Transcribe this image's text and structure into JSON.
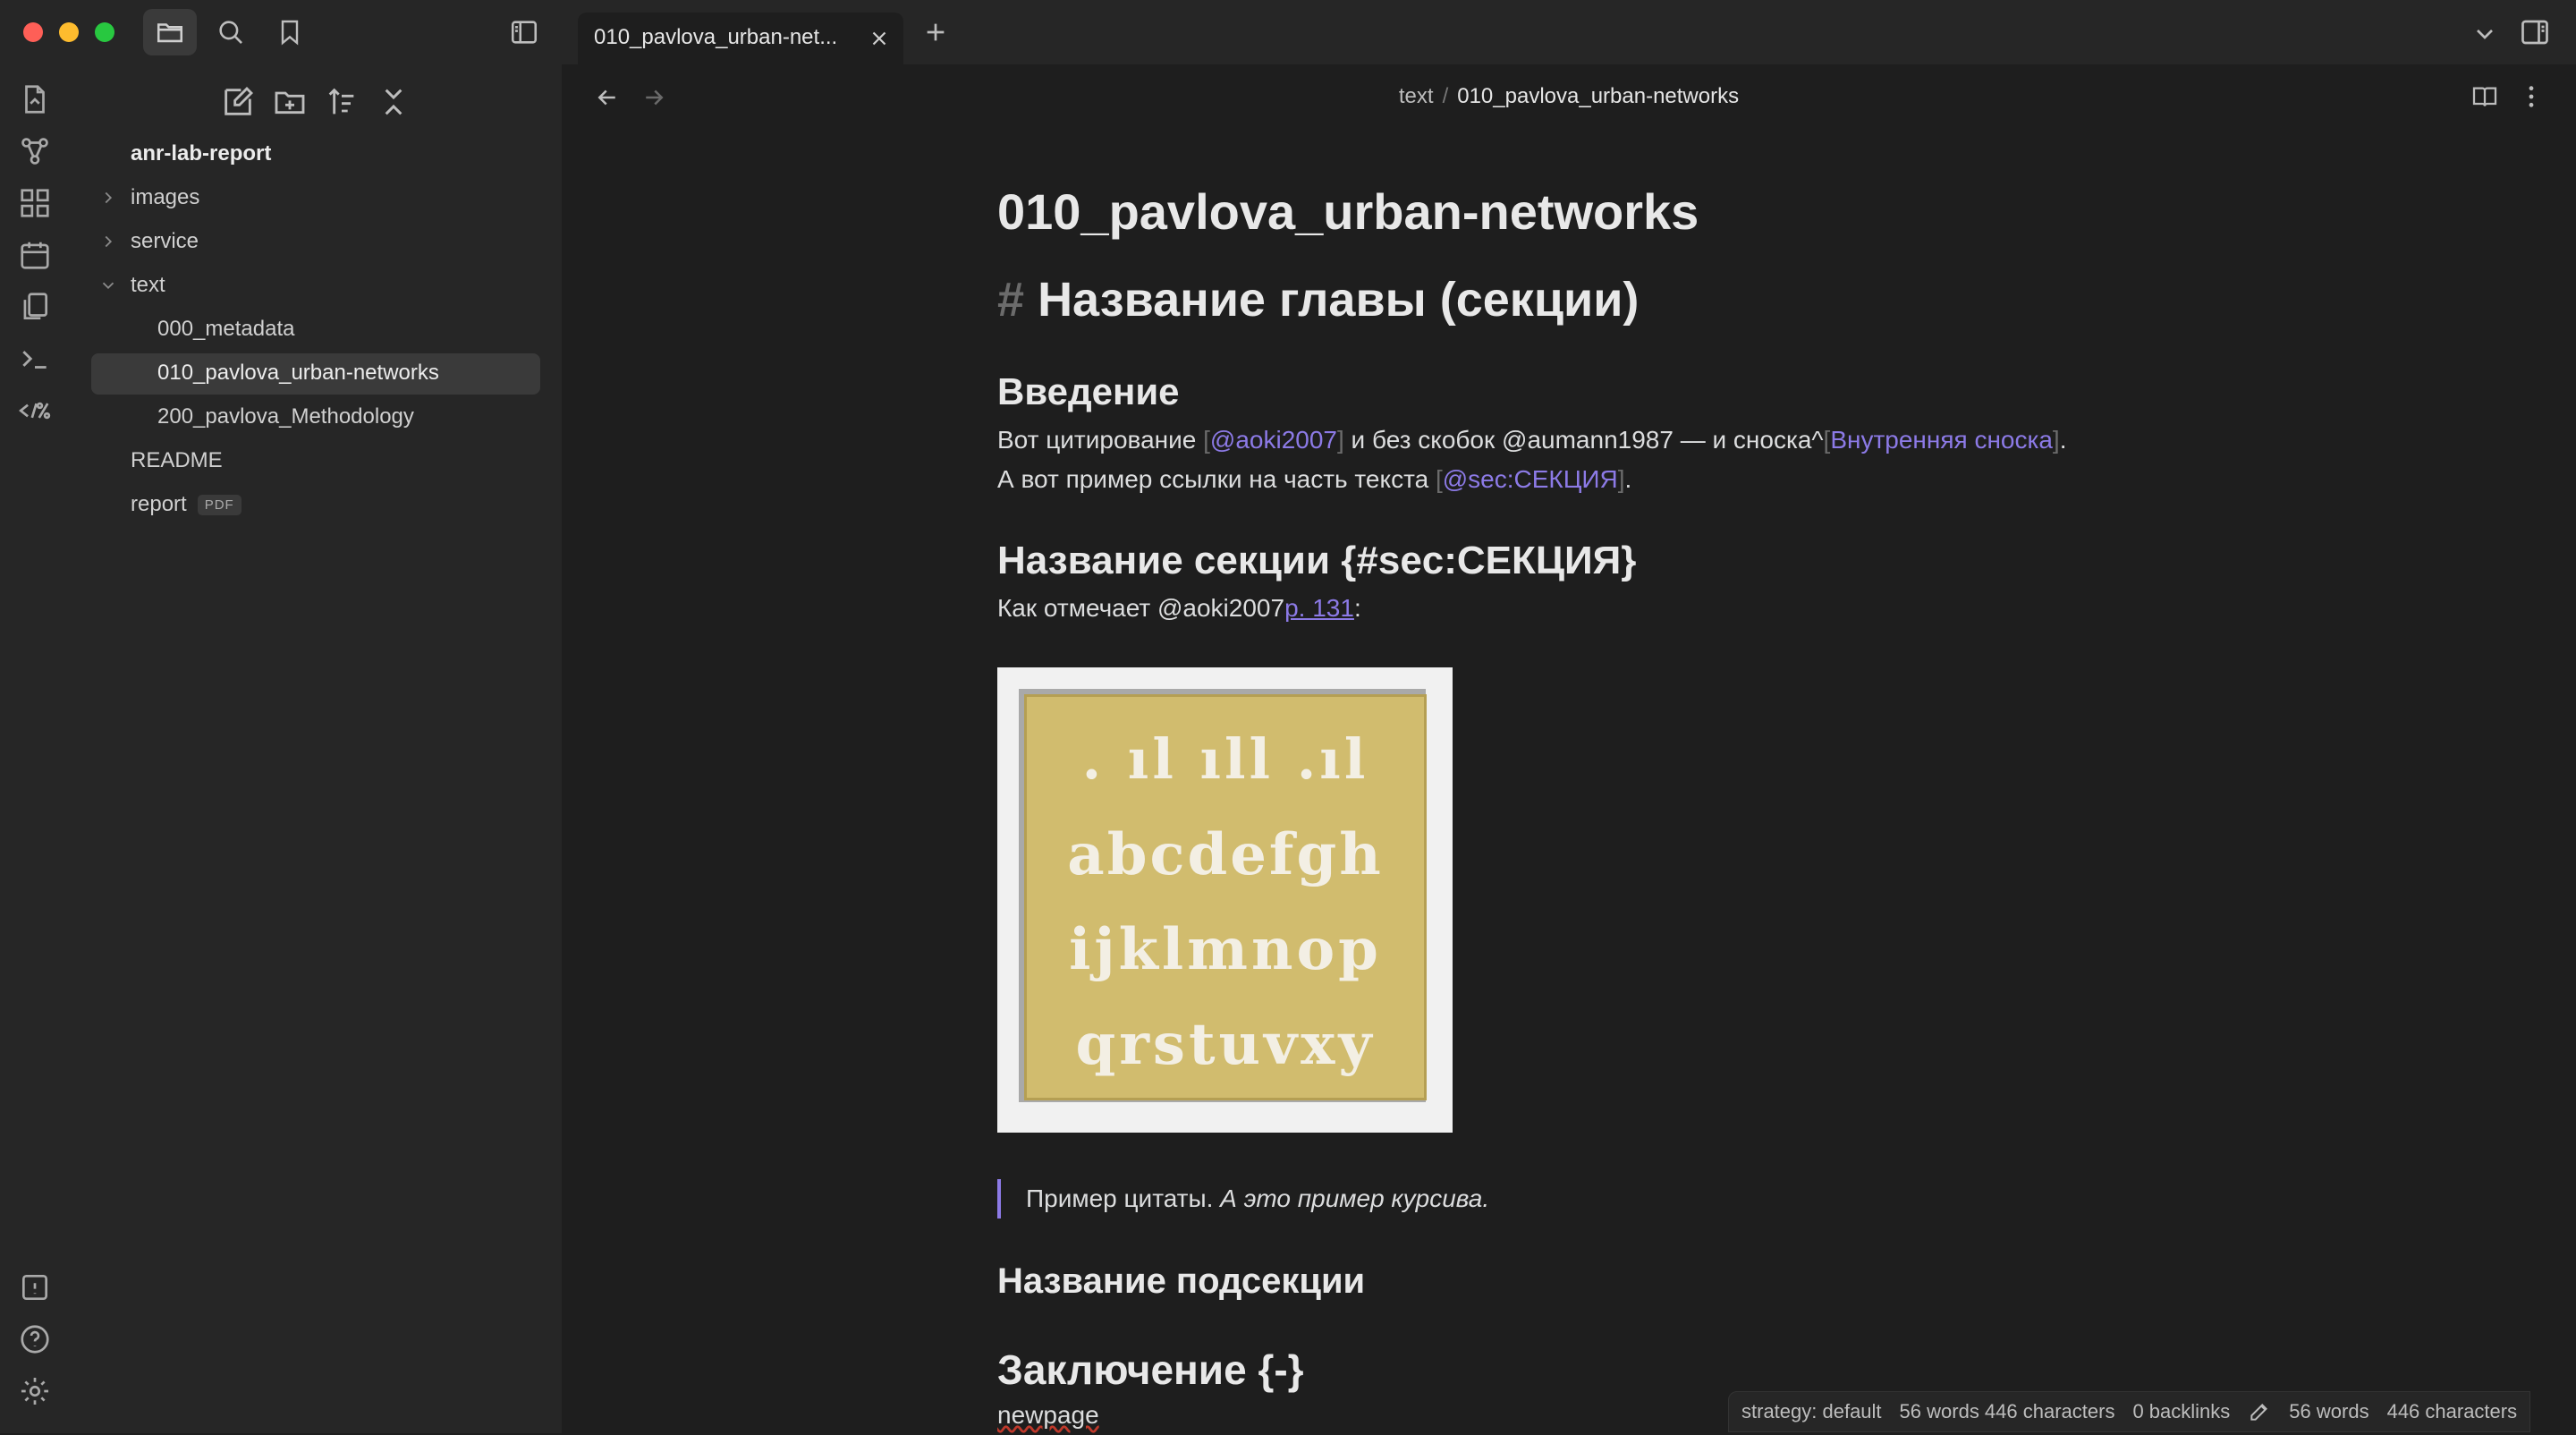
{
  "tab": {
    "label": "010_pavlova_urban-net..."
  },
  "breadcrumb": {
    "folder": "text",
    "separator": "/",
    "file": "010_pavlova_urban-networks"
  },
  "file_tree": {
    "root": "anr-lab-report",
    "folders": {
      "images": "images",
      "service": "service",
      "text": "text"
    },
    "text_children": [
      "000_metadata",
      "010_pavlova_urban-networks",
      "200_pavlova_Methodology"
    ],
    "readme": "README",
    "report": "report",
    "report_badge": "PDF"
  },
  "note": {
    "title": "010_pavlova_urban-networks",
    "h1_marker": "#",
    "h1": "Название главы (секции)",
    "intro_heading": "Введение",
    "p1": {
      "t1": "Вот цитирование ",
      "cite1": "@aoki2007",
      "t2": " и без скобок @aumann1987 — и сноска^",
      "footnote": "Внутренняя сноска",
      "t3": ". А вот пример ссылки на часть текста ",
      "ref": "@sec:СЕКЦИЯ",
      "t4": "."
    },
    "section_heading": "Название секции {#sec:СЕКЦИЯ}",
    "p2": {
      "t1": "Как отмечает @aoki2007",
      "link": "p. 131",
      "t2": ":"
    },
    "image_letters": [
      ". ıl ıll .ıl",
      "abcdefgh",
      "ijklmnop",
      "qrstuvxy"
    ],
    "quote": {
      "plain": "Пример цитаты. ",
      "italic": "А это пример курсива."
    },
    "subsection_heading": "Название подсекции",
    "conclusion_heading": "Заключение {-}",
    "last_line": "newpage"
  },
  "status": {
    "strategy": "strategy: default",
    "counts": "56 words 446 characters",
    "backlinks": "0 backlinks",
    "words": "56 words",
    "chars": "446 characters"
  },
  "colors": {
    "accent": "#8c7ae6",
    "background": "#1e1e1e",
    "sidebar": "#262626",
    "image_plate": "#d1bc6e"
  }
}
